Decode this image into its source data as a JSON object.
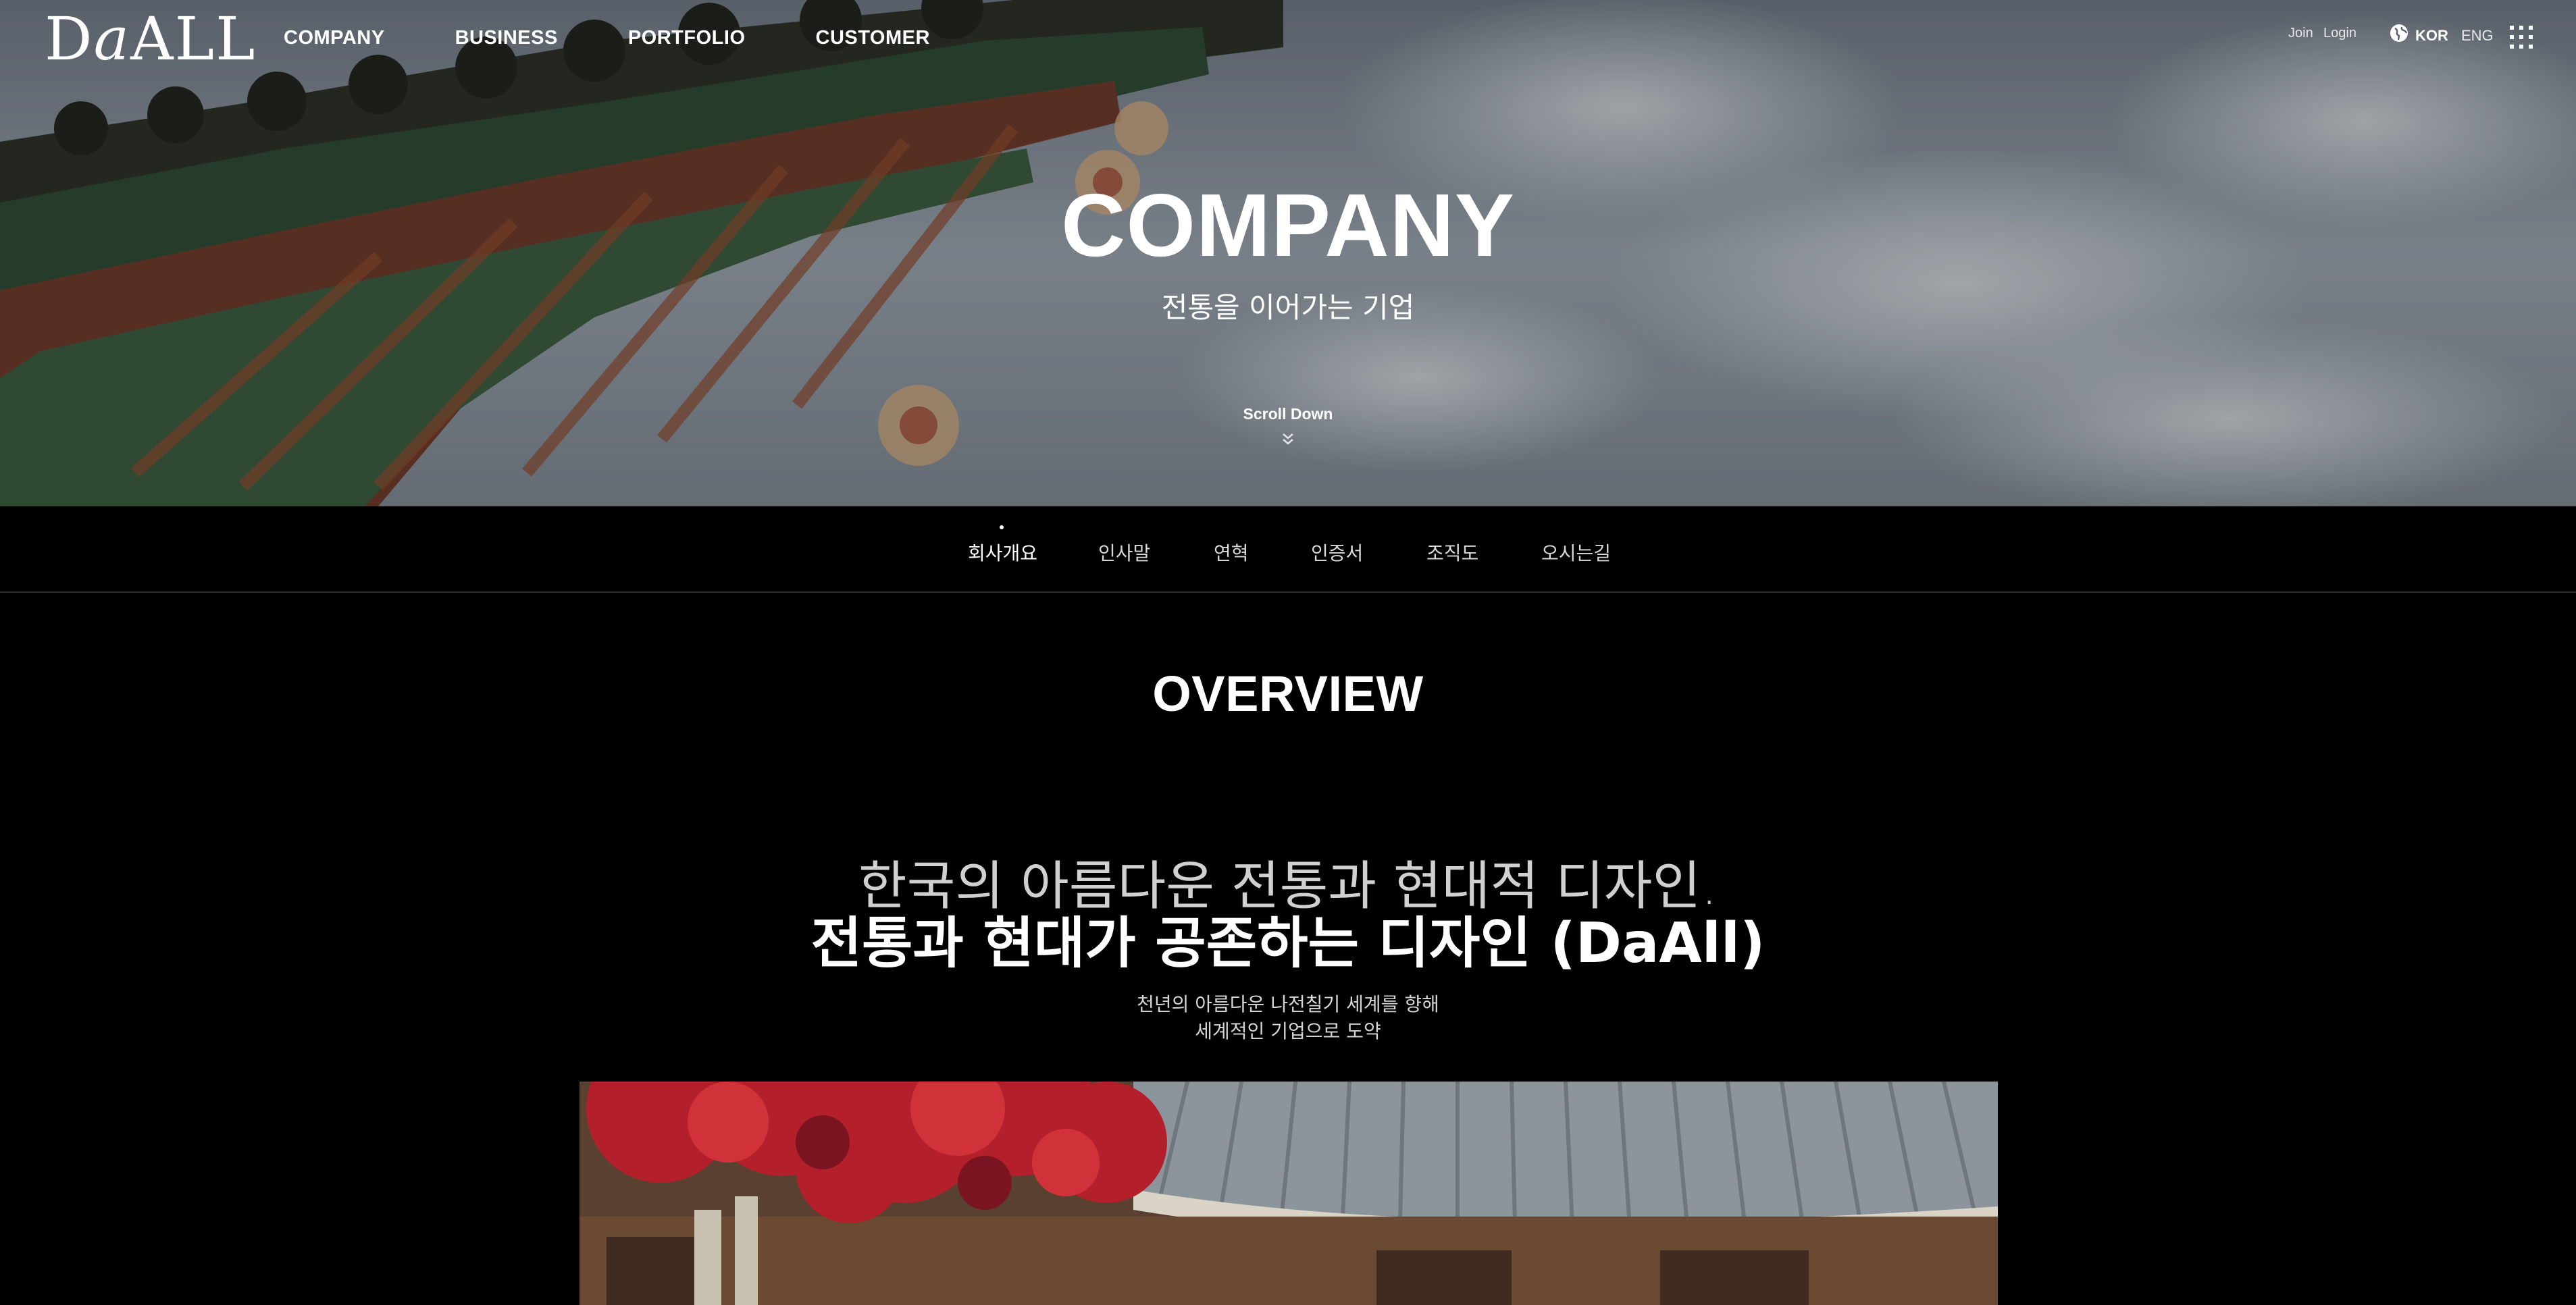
{
  "header": {
    "logo": {
      "part1": "D",
      "part2": "a",
      "part3": "ALL"
    },
    "nav": [
      "COMPANY",
      "BUSINESS",
      "PORTFOLIO",
      "CUSTOMER"
    ],
    "util": {
      "join": "Join",
      "login": "Login"
    },
    "languages": {
      "active": "KOR",
      "inactive": "ENG"
    },
    "icons": {
      "language": "globe-icon",
      "menu": "grid-menu-icon"
    }
  },
  "hero": {
    "title": "COMPANY",
    "subtitle": "전통을 이어가는 기업",
    "scroll_label": "Scroll Down",
    "scroll_icon": "chevron-double-down-icon"
  },
  "subnav": {
    "items": [
      "회사개요",
      "인사말",
      "연혁",
      "인증서",
      "조직도",
      "오시는길"
    ],
    "active_index": 0
  },
  "overview": {
    "title": "OVERVIEW",
    "tagline_light": "한국의 아름다운 전통과 현대적 디자인.",
    "tagline_bold": "전통과 현대가 공존하는 디자인 (DaAll)",
    "desc_line1": "천년의 아름다운 나전칠기 세계를 향해",
    "desc_line2": "세계적인 기업으로 도약"
  },
  "colors": {
    "background": "#000000",
    "text": "#ffffff",
    "subtext": "#d6d6d6"
  }
}
